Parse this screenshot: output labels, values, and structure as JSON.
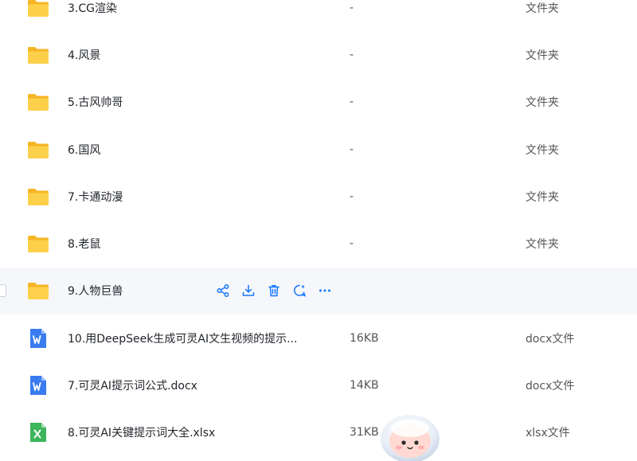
{
  "files": [
    {
      "name": "3.CG渲染",
      "size": "-",
      "type": "文件夹",
      "kind": "folder"
    },
    {
      "name": "4.风景",
      "size": "-",
      "type": "文件夹",
      "kind": "folder"
    },
    {
      "name": "5.古风帅哥",
      "size": "-",
      "type": "文件夹",
      "kind": "folder"
    },
    {
      "name": "6.国风",
      "size": "-",
      "type": "文件夹",
      "kind": "folder"
    },
    {
      "name": "7.卡通动漫",
      "size": "-",
      "type": "文件夹",
      "kind": "folder"
    },
    {
      "name": "8.老鼠",
      "size": "-",
      "type": "文件夹",
      "kind": "folder"
    },
    {
      "name": "9.人物巨兽",
      "size": "",
      "type": "",
      "kind": "folder"
    },
    {
      "name": "10.用DeepSeek生成可灵AI文生视频的提示...",
      "size": "16KB",
      "type": "docx文件",
      "kind": "docx"
    },
    {
      "name": "7.可灵AI提示词公式.docx",
      "size": "14KB",
      "type": "docx文件",
      "kind": "docx"
    },
    {
      "name": "8.可灵AI关键提示词大全.xlsx",
      "size": "31KB",
      "type": "xlsx文件",
      "kind": "xlsx"
    }
  ],
  "colors": {
    "accent": "#1677ff",
    "folder": "#f7c034",
    "docx": "#3a7bf0",
    "xlsx": "#3cb55b",
    "hover_row": "#f5f7fb"
  },
  "icons": {
    "folder": "folder-icon",
    "docx": "word-doc-icon",
    "xlsx": "excel-sheet-icon",
    "actions": [
      "share-icon",
      "download-icon",
      "delete-icon",
      "ai-chat-icon",
      "more-icon"
    ]
  }
}
